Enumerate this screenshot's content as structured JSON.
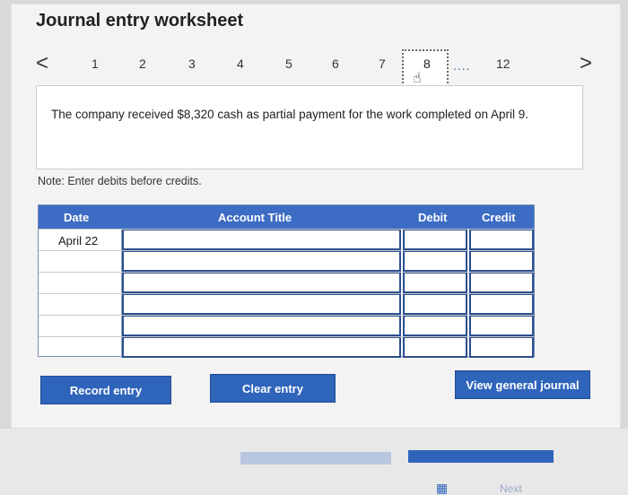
{
  "title": "Journal entry worksheet",
  "pager": {
    "prev_icon": "<",
    "next_icon": ">",
    "pages": [
      "1",
      "2",
      "3",
      "4",
      "5",
      "6",
      "7"
    ],
    "active": "8",
    "ellipsis": "....",
    "last": "12"
  },
  "description": "The company received $8,320 cash as partial payment for the work completed on April 9.",
  "note": "Note: Enter debits before credits.",
  "table": {
    "headers": {
      "date": "Date",
      "account": "Account Title",
      "debit": "Debit",
      "credit": "Credit"
    },
    "rows": [
      {
        "date": "April 22",
        "account": "",
        "debit": "",
        "credit": ""
      },
      {
        "date": "",
        "account": "",
        "debit": "",
        "credit": ""
      },
      {
        "date": "",
        "account": "",
        "debit": "",
        "credit": ""
      },
      {
        "date": "",
        "account": "",
        "debit": "",
        "credit": ""
      },
      {
        "date": "",
        "account": "",
        "debit": "",
        "credit": ""
      },
      {
        "date": "",
        "account": "",
        "debit": "",
        "credit": ""
      }
    ]
  },
  "buttons": {
    "record": "Record entry",
    "clear": "Clear entry",
    "view": "View general journal"
  },
  "footer": {
    "next": "Next"
  }
}
